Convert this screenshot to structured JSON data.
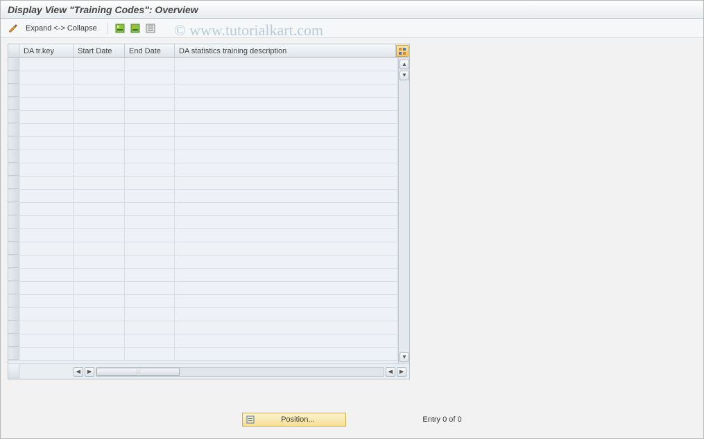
{
  "title": "Display View \"Training Codes\": Overview",
  "toolbar": {
    "edit_icon_name": "pencil-glasses-icon",
    "expand_label": "Expand <-> Collapse",
    "select_all_name": "select-all-icon",
    "select_block_name": "select-block-icon",
    "deselect_all_name": "deselect-all-icon"
  },
  "table": {
    "headers": {
      "col1": "DA tr.key",
      "col2": "Start Date",
      "col3": "End Date",
      "col4": "DA statistics training description"
    },
    "config_icon_name": "table-settings-icon",
    "row_count": 23
  },
  "footer": {
    "position_label": "Position...",
    "position_icon_name": "position-locator-icon",
    "entry_text": "Entry 0 of 0"
  },
  "watermark": "© www.tutorialkart.com"
}
